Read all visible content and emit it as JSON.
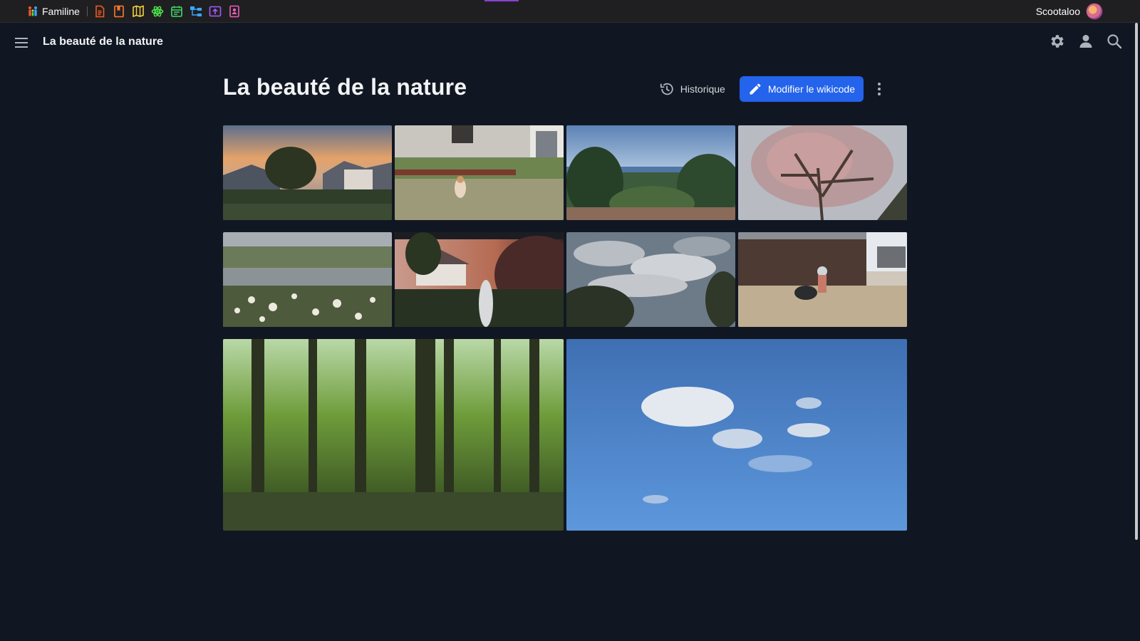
{
  "topbar": {
    "brand_label": "Familine",
    "user_name": "Scootaloo",
    "apps": [
      {
        "icon": "document-icon",
        "color": "#f15a24"
      },
      {
        "icon": "bookmark-icon",
        "color": "#ff7a2f"
      },
      {
        "icon": "map-icon",
        "color": "#f4d23c"
      },
      {
        "icon": "atom-icon",
        "color": "#4ee24a"
      },
      {
        "icon": "calendar-icon",
        "color": "#3fd96c"
      },
      {
        "icon": "sitemap-icon",
        "color": "#3aa6ff"
      },
      {
        "icon": "upload-icon",
        "color": "#a65bff"
      },
      {
        "icon": "contact-icon",
        "color": "#e95fb9"
      }
    ]
  },
  "header": {
    "page_name": "La beauté de la nature"
  },
  "main": {
    "title": "La beauté de la nature",
    "history_label": "Historique",
    "edit_label": "Modifier le wikicode",
    "accent_color": "#2463eb"
  },
  "gallery": {
    "photos": [
      {
        "name": "sunset-houses"
      },
      {
        "name": "cat-in-yard"
      },
      {
        "name": "landscape-view"
      },
      {
        "name": "blossom-tree"
      },
      {
        "name": "pond-flowers"
      },
      {
        "name": "sunset-garden"
      },
      {
        "name": "cloudy-sky"
      },
      {
        "name": "dog-in-stable"
      },
      {
        "name": "green-forest"
      },
      {
        "name": "blue-sky"
      }
    ]
  }
}
